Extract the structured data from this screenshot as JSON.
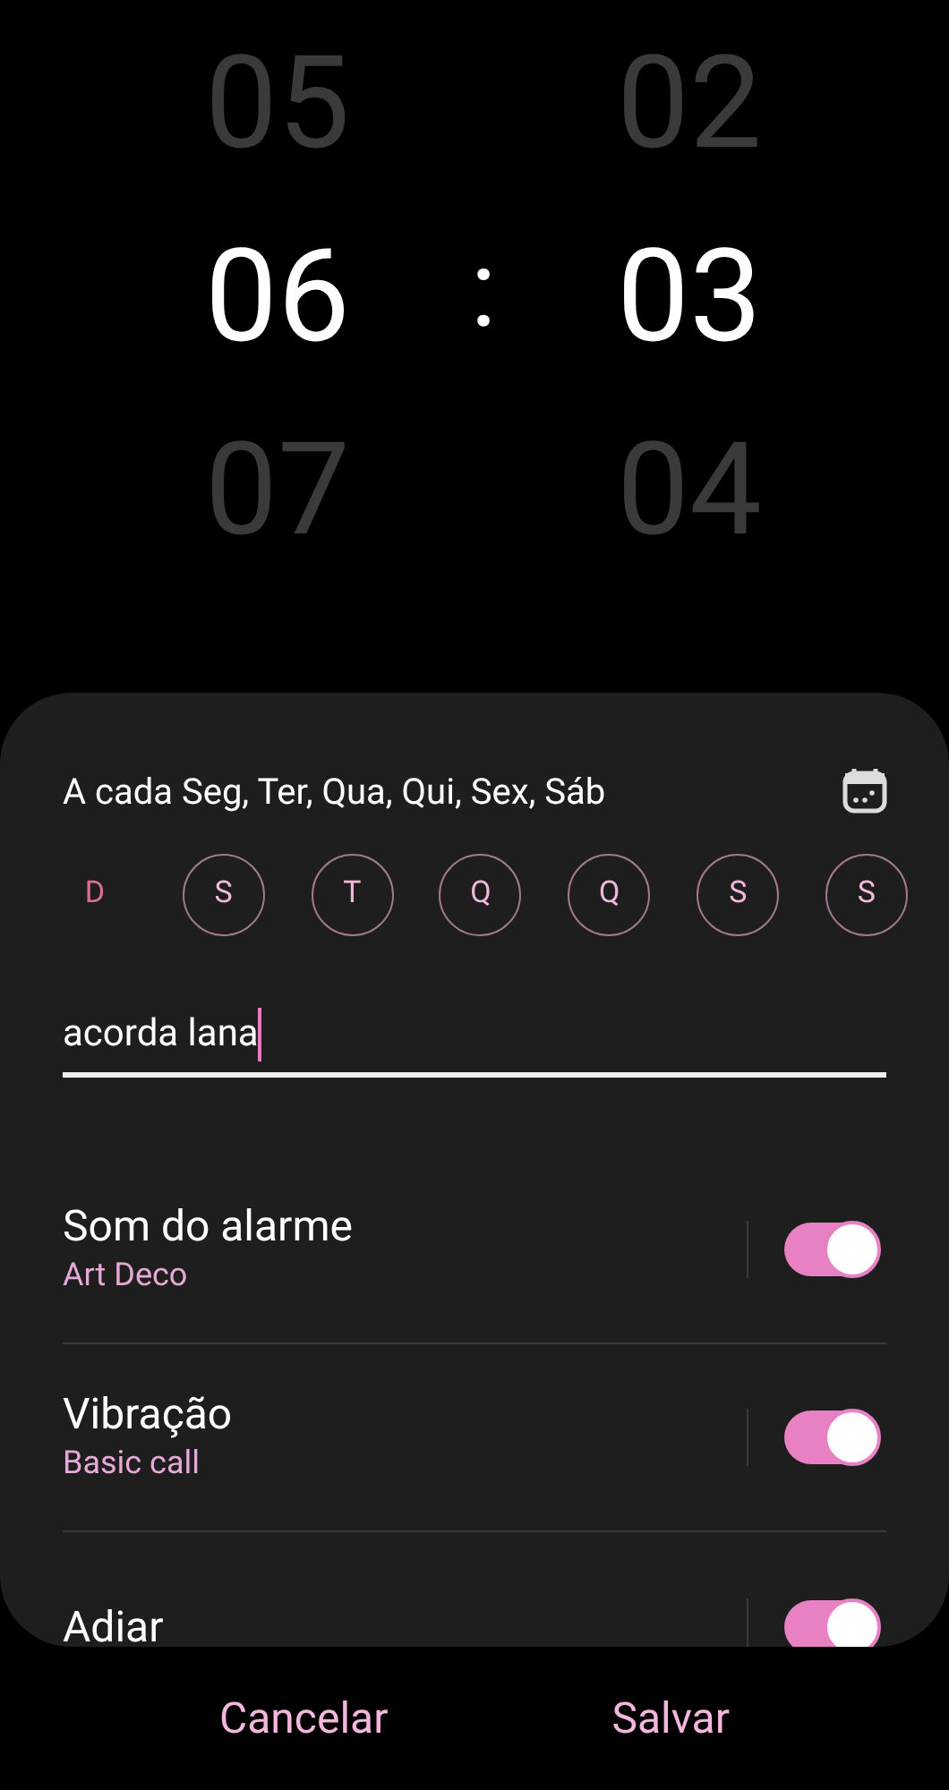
{
  "time_picker": {
    "hours": [
      {
        "value": "05",
        "selected": false
      },
      {
        "value": "06",
        "selected": true
      },
      {
        "value": "07",
        "selected": false
      }
    ],
    "separator": ":",
    "minutes": [
      {
        "value": "02",
        "selected": false
      },
      {
        "value": "03",
        "selected": true
      },
      {
        "value": "04",
        "selected": false
      }
    ]
  },
  "repeat": {
    "label": "A cada Seg, Ter, Qua, Qui, Sex, Sáb"
  },
  "days": [
    {
      "label": "D",
      "selected": false,
      "color": "#d9708c"
    },
    {
      "label": "S",
      "selected": true,
      "color": "#f3b6dd"
    },
    {
      "label": "T",
      "selected": true,
      "color": "#f3b6dd"
    },
    {
      "label": "Q",
      "selected": true,
      "color": "#f3b6dd"
    },
    {
      "label": "Q",
      "selected": true,
      "color": "#f3b6dd"
    },
    {
      "label": "S",
      "selected": true,
      "color": "#f3b6dd"
    },
    {
      "label": "S",
      "selected": true,
      "color": "#f3b6dd"
    }
  ],
  "alarm_name": {
    "value": "acorda lana"
  },
  "settings": [
    {
      "title": "Som do alarme",
      "subtitle": "Art Deco",
      "on": true
    },
    {
      "title": "Vibração",
      "subtitle": "Basic call",
      "on": true
    },
    {
      "title": "Adiar",
      "on": true
    }
  ],
  "buttons": [
    {
      "label": "Cancelar"
    },
    {
      "label": "Salvar"
    }
  ]
}
